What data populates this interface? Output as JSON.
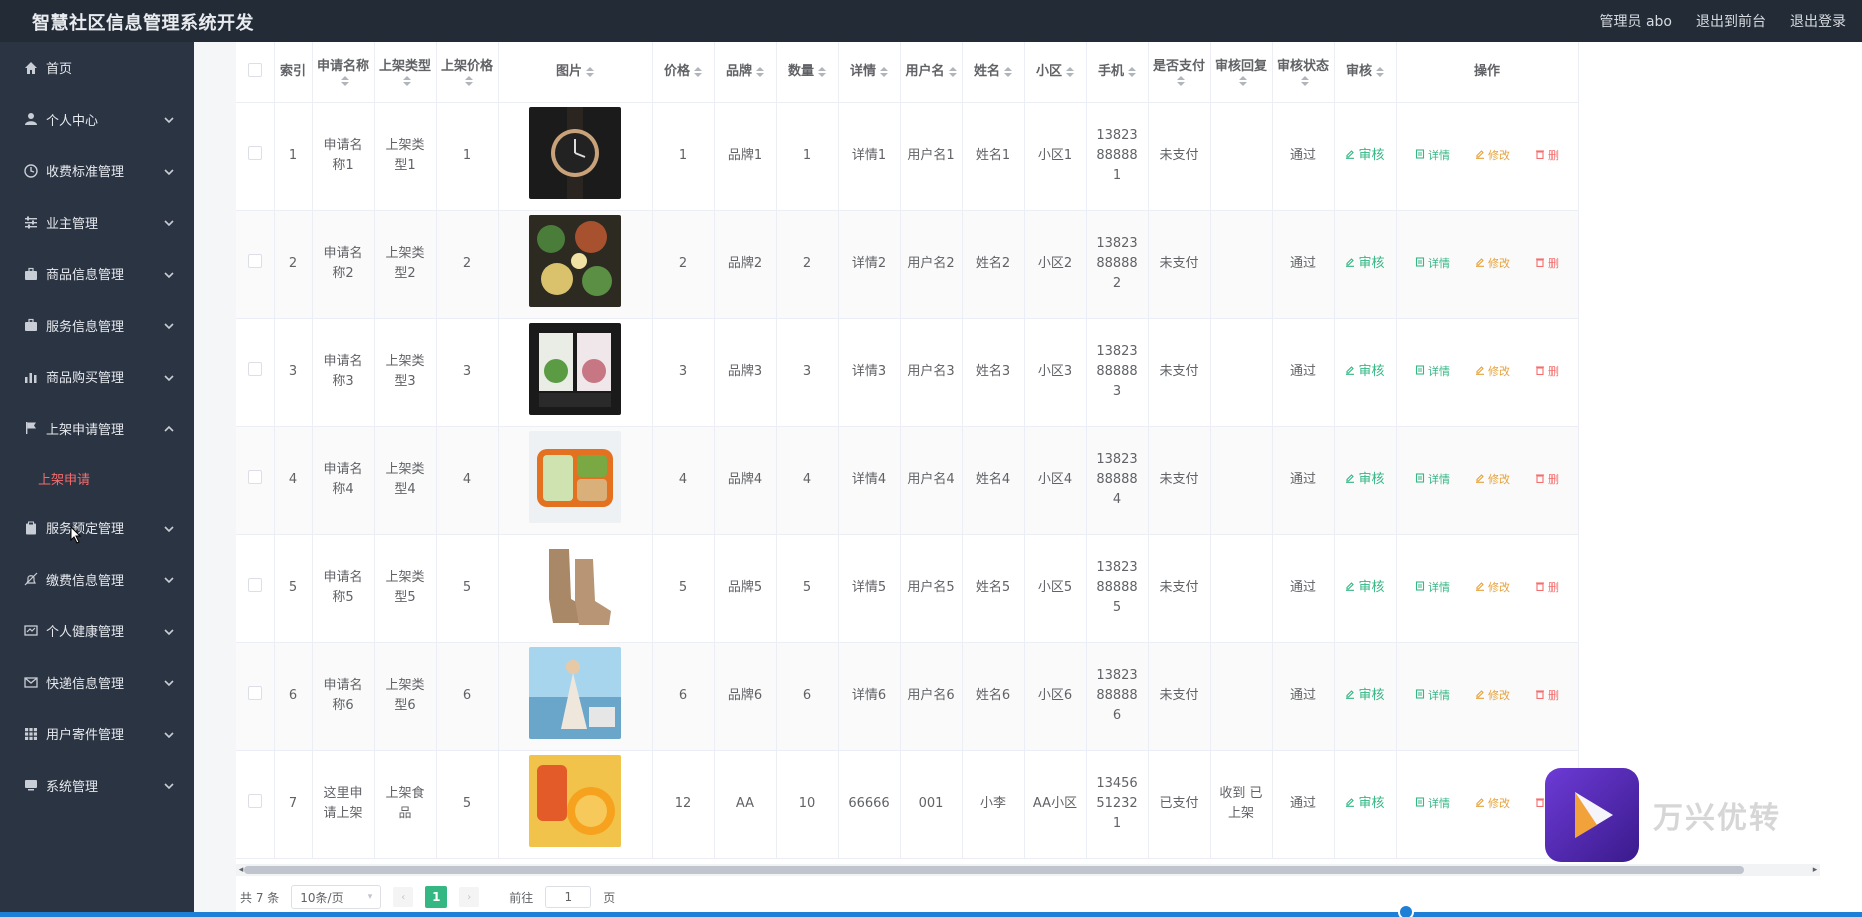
{
  "app": {
    "title": "智慧社区信息管理系统开发",
    "admin_label": "管理员 abo",
    "goto_front": "退出到前台",
    "logout": "退出登录"
  },
  "sidebar": {
    "items": [
      {
        "label": "首页",
        "icon": "home-icon",
        "has_chevron": false
      },
      {
        "label": "个人中心",
        "icon": "user-icon",
        "has_chevron": true
      },
      {
        "label": "收费标准管理",
        "icon": "clock-icon",
        "has_chevron": true
      },
      {
        "label": "业主管理",
        "icon": "sliders-icon",
        "has_chevron": true
      },
      {
        "label": "商品信息管理",
        "icon": "briefcase-icon",
        "has_chevron": true
      },
      {
        "label": "服务信息管理",
        "icon": "briefcase-icon",
        "has_chevron": true
      },
      {
        "label": "商品购买管理",
        "icon": "bar-chart-icon",
        "has_chevron": true
      },
      {
        "label": "上架申请管理",
        "icon": "flag-icon",
        "has_chevron": true,
        "expanded": true
      },
      {
        "label": "服务预定管理",
        "icon": "clipboard-icon",
        "has_chevron": true
      },
      {
        "label": "缴费信息管理",
        "icon": "bell-off-icon",
        "has_chevron": true
      },
      {
        "label": "个人健康管理",
        "icon": "monitor-icon",
        "has_chevron": true
      },
      {
        "label": "快递信息管理",
        "icon": "mail-icon",
        "has_chevron": true
      },
      {
        "label": "用户寄件管理",
        "icon": "grid-icon",
        "has_chevron": true
      },
      {
        "label": "系统管理",
        "icon": "desktop-icon",
        "has_chevron": true
      }
    ],
    "active_sub": "上架申请"
  },
  "table": {
    "headers": {
      "index": "索引",
      "apply_name": "申请名称",
      "shelf_type": "上架类型",
      "shelf_price": "上架价格",
      "image": "图片",
      "price": "价格",
      "brand": "品牌",
      "qty": "数量",
      "detail": "详情",
      "username": "用户名",
      "name": "姓名",
      "community": "小区",
      "phone": "手机",
      "paid": "是否支付",
      "review_reply": "审核回复",
      "review_status": "审核状态",
      "review": "审核",
      "actions": "操作"
    },
    "action_labels": {
      "review": "审核",
      "detail": "详情",
      "edit": "修改",
      "delete": "删"
    },
    "rows": [
      {
        "index": "1",
        "apply_name": "申请名称1",
        "shelf_type": "上架类型1",
        "shelf_price": "1",
        "image": "watch-image",
        "price": "1",
        "brand": "品牌1",
        "qty": "1",
        "detail": "详情1",
        "username": "用户名1",
        "name": "姓名1",
        "community": "小区1",
        "phone": "13823888881",
        "paid": "未支付",
        "review_reply": "",
        "review_status": "通过"
      },
      {
        "index": "2",
        "apply_name": "申请名称2",
        "shelf_type": "上架类型2",
        "shelf_price": "2",
        "image": "food-image",
        "price": "2",
        "brand": "品牌2",
        "qty": "2",
        "detail": "详情2",
        "username": "用户名2",
        "name": "姓名2",
        "community": "小区2",
        "phone": "13823888882",
        "paid": "未支付",
        "review_reply": "",
        "review_status": "通过"
      },
      {
        "index": "3",
        "apply_name": "申请名称3",
        "shelf_type": "上架类型3",
        "shelf_price": "3",
        "image": "tea-image",
        "price": "3",
        "brand": "品牌3",
        "qty": "3",
        "detail": "详情3",
        "username": "用户名3",
        "name": "姓名3",
        "community": "小区3",
        "phone": "13823888883",
        "paid": "未支付",
        "review_reply": "",
        "review_status": "通过"
      },
      {
        "index": "4",
        "apply_name": "申请名称4",
        "shelf_type": "上架类型4",
        "shelf_price": "4",
        "image": "lunchbox-image",
        "price": "4",
        "brand": "品牌4",
        "qty": "4",
        "detail": "详情4",
        "username": "用户名4",
        "name": "姓名4",
        "community": "小区4",
        "phone": "13823888884",
        "paid": "未支付",
        "review_reply": "",
        "review_status": "通过"
      },
      {
        "index": "5",
        "apply_name": "申请名称5",
        "shelf_type": "上架类型5",
        "shelf_price": "5",
        "image": "boots-image",
        "price": "5",
        "brand": "品牌5",
        "qty": "5",
        "detail": "详情5",
        "username": "用户名5",
        "name": "姓名5",
        "community": "小区5",
        "phone": "13823888885",
        "paid": "未支付",
        "review_reply": "",
        "review_status": "通过"
      },
      {
        "index": "6",
        "apply_name": "申请名称6",
        "shelf_type": "上架类型6",
        "shelf_price": "6",
        "image": "dress-image",
        "price": "6",
        "brand": "品牌6",
        "qty": "6",
        "detail": "详情6",
        "username": "用户名6",
        "name": "姓名6",
        "community": "小区6",
        "phone": "13823888886",
        "paid": "未支付",
        "review_reply": "",
        "review_status": "通过"
      },
      {
        "index": "7",
        "apply_name": "这里申请上架",
        "shelf_type": "上架食品",
        "shelf_price": "5",
        "image": "snack-image",
        "price": "12",
        "brand": "AA",
        "qty": "10",
        "detail": "66666",
        "username": "001",
        "name": "小李",
        "community": "AA小区",
        "phone": "13456512321",
        "paid": "已支付",
        "review_reply": "收到 已上架",
        "review_status": "通过"
      }
    ]
  },
  "pagination": {
    "total": "共 7 条",
    "page_size": "10条/页",
    "current": "1",
    "goto_label": "前往",
    "goto_value": "1",
    "page_unit": "页"
  },
  "watermark": "万兴优转",
  "colors": {
    "accent": "#35b784",
    "danger": "#f56c6c",
    "warning": "#e6a23c",
    "sidebar_bg": "#2b3442",
    "topbar_bg": "#232b36"
  }
}
